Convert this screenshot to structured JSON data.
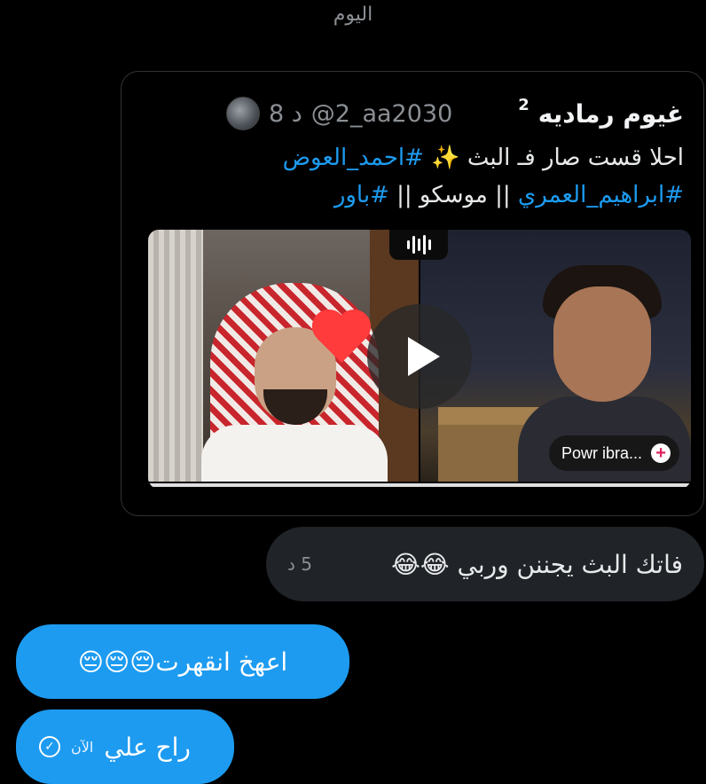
{
  "day_separator": "اليوم",
  "shared_tweet": {
    "author_name": "غيوم رماديه",
    "author_sup": "2",
    "handle": "@2_aa2030",
    "time": "8 د",
    "text_plain_1": "احلا قست صار فـ البث ✨ ",
    "hashtag_1": "#احمد_العوض",
    "hashtag_2": "#ابراهيم_العمري",
    "text_plain_2": " || موسكو || ",
    "hashtag_3": "#باور",
    "media": {
      "chip_label": "Powr ibra...",
      "audio_icon": "audio-wave-icon",
      "play_icon": "play-icon",
      "progress": 1.0
    }
  },
  "messages": [
    {
      "direction": "received",
      "text": "فاتك البث يجننن وربي 😂😂",
      "time": "5 د"
    },
    {
      "direction": "sent",
      "text": "اعهخ انقهرت😔😔😔"
    },
    {
      "direction": "sent",
      "text": "راح علي",
      "time": "الآن",
      "status_icon": "check-circle-icon"
    }
  ],
  "colors": {
    "accent": "#1d9bf0",
    "received_bubble": "#202327",
    "background": "#000000"
  }
}
